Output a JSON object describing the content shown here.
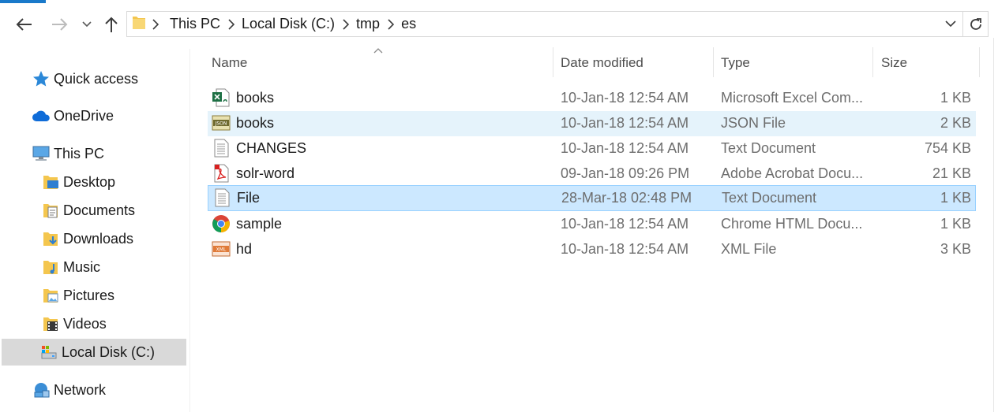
{
  "breadcrumb": [
    "This PC",
    "Local Disk (C:)",
    "tmp",
    "es"
  ],
  "sidebar": {
    "items": [
      {
        "label": "Quick access",
        "icon": "star-icon"
      },
      {
        "label": "OneDrive",
        "icon": "cloud-icon"
      },
      {
        "label": "This PC",
        "icon": "computer-icon"
      },
      {
        "label": "Desktop",
        "icon": "desktop-folder-icon"
      },
      {
        "label": "Documents",
        "icon": "documents-folder-icon"
      },
      {
        "label": "Downloads",
        "icon": "downloads-folder-icon"
      },
      {
        "label": "Music",
        "icon": "music-folder-icon"
      },
      {
        "label": "Pictures",
        "icon": "pictures-folder-icon"
      },
      {
        "label": "Videos",
        "icon": "videos-folder-icon"
      },
      {
        "label": "Local Disk (C:)",
        "icon": "drive-icon",
        "selected": true
      },
      {
        "label": "Network",
        "icon": "network-icon"
      }
    ]
  },
  "columns": {
    "name": "Name",
    "date": "Date modified",
    "type": "Type",
    "size": "Size"
  },
  "files": [
    {
      "name": "books",
      "date": "10-Jan-18 12:54 AM",
      "type": "Microsoft Excel Com...",
      "size": "1 KB",
      "icon": "excel-file-icon"
    },
    {
      "name": "books",
      "date": "10-Jan-18 12:54 AM",
      "type": "JSON File",
      "size": "2 KB",
      "icon": "json-file-icon",
      "state": "hover"
    },
    {
      "name": "CHANGES",
      "date": "10-Jan-18 12:54 AM",
      "type": "Text Document",
      "size": "754 KB",
      "icon": "text-file-icon"
    },
    {
      "name": "solr-word",
      "date": "09-Jan-18 09:26 PM",
      "type": "Adobe Acrobat Docu...",
      "size": "21 KB",
      "icon": "pdf-file-icon"
    },
    {
      "name": "File",
      "date": "28-Mar-18 02:48 PM",
      "type": "Text Document",
      "size": "1 KB",
      "icon": "text-file-icon",
      "state": "selected"
    },
    {
      "name": "sample",
      "date": "10-Jan-18 12:54 AM",
      "type": "Chrome HTML Docu...",
      "size": "1 KB",
      "icon": "chrome-html-icon"
    },
    {
      "name": "hd",
      "date": "10-Jan-18 12:54 AM",
      "type": "XML File",
      "size": "3 KB",
      "icon": "xml-file-icon"
    }
  ],
  "colors": {
    "accent": "#1979ca",
    "row_hover": "#e5f3fb",
    "row_selected": "#cce8ff",
    "row_selected_border": "#99d1ff",
    "sidebar_selected": "#d9d9d9"
  }
}
